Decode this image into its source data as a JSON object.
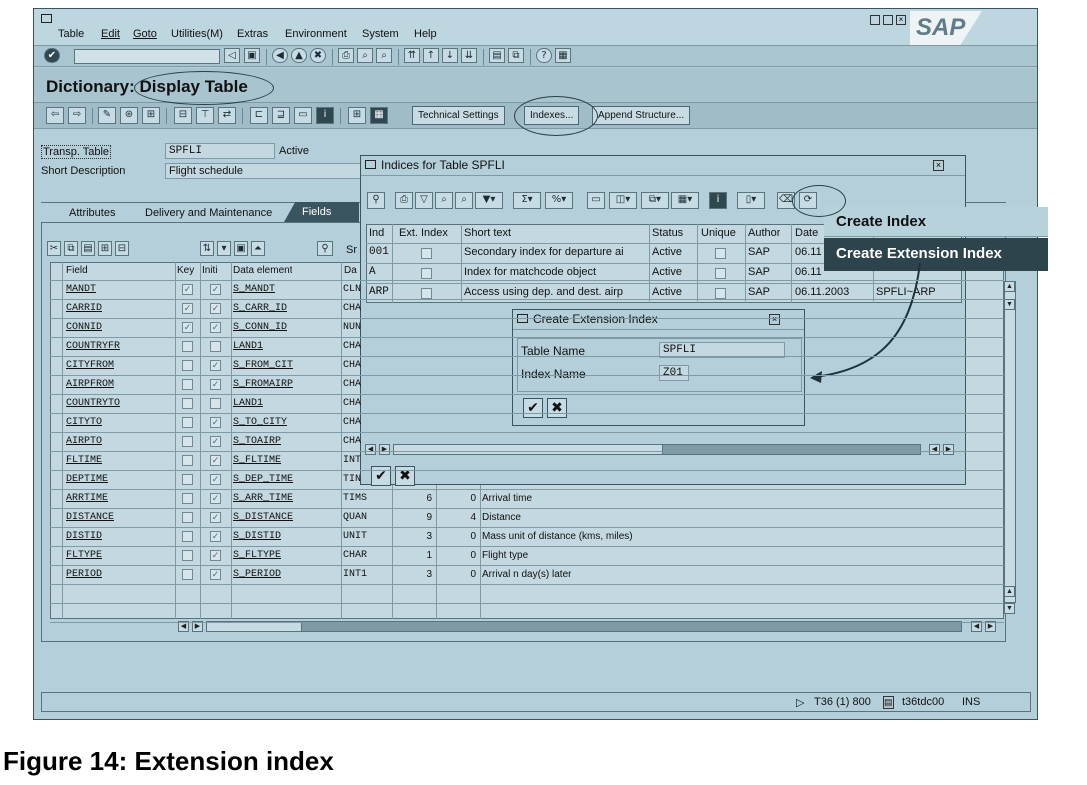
{
  "menu": {
    "items": [
      "Table",
      "Edit",
      "Goto",
      "Utilities(M)",
      "Extras",
      "Environment",
      "System",
      "Help"
    ]
  },
  "brand": {
    "logo": "SAP"
  },
  "title": {
    "text": "Dictionary: Display Table"
  },
  "app_toolbar": {
    "technical_settings": "Technical Settings",
    "indexes": "Indexes...",
    "append_structure": "Append Structure..."
  },
  "header": {
    "transp_label": "Transp. Table",
    "transp_value": "SPFLI",
    "status": "Active",
    "short_desc_label": "Short Description",
    "short_desc_value": "Flight schedule"
  },
  "tabs": [
    "Attributes",
    "Delivery and Maintenance",
    "Fields"
  ],
  "fields_table": {
    "search_label": "Sr",
    "columns": [
      "Field",
      "Key",
      "Initi",
      "Data element",
      "Da"
    ],
    "rows": [
      {
        "field": "MANDT",
        "key": true,
        "init": true,
        "element": "S_MANDT",
        "type": "CLN",
        "len": "",
        "dec": "",
        "desc": ""
      },
      {
        "field": "CARRID",
        "key": true,
        "init": true,
        "element": "S_CARR_ID",
        "type": "CHA",
        "len": "",
        "dec": "",
        "desc": ""
      },
      {
        "field": "CONNID",
        "key": true,
        "init": true,
        "element": "S_CONN_ID",
        "type": "NUN",
        "len": "",
        "dec": "",
        "desc": ""
      },
      {
        "field": "COUNTRYFR",
        "key": false,
        "init": false,
        "element": "LAND1",
        "type": "CHA",
        "len": "",
        "dec": "",
        "desc": ""
      },
      {
        "field": "CITYFROM",
        "key": false,
        "init": true,
        "element": "S_FROM_CIT",
        "type": "CHA",
        "len": "",
        "dec": "",
        "desc": ""
      },
      {
        "field": "AIRPFROM",
        "key": false,
        "init": true,
        "element": "S_FROMAIRP",
        "type": "CHA",
        "len": "",
        "dec": "",
        "desc": ""
      },
      {
        "field": "COUNTRYTO",
        "key": false,
        "init": false,
        "element": "LAND1",
        "type": "CHA",
        "len": "",
        "dec": "",
        "desc": ""
      },
      {
        "field": "CITYTO",
        "key": false,
        "init": true,
        "element": "S_TO_CITY",
        "type": "CHA",
        "len": "",
        "dec": "",
        "desc": ""
      },
      {
        "field": "AIRPTO",
        "key": false,
        "init": true,
        "element": "S_TOAIRP",
        "type": "CHA",
        "len": "",
        "dec": "",
        "desc": ""
      },
      {
        "field": "FLTIME",
        "key": false,
        "init": true,
        "element": "S_FLTIME",
        "type": "INT",
        "len": "",
        "dec": "",
        "desc": ""
      },
      {
        "field": "DEPTIME",
        "key": false,
        "init": true,
        "element": "S_DEP_TIME",
        "type": "TIN",
        "len": "",
        "dec": "",
        "desc": ""
      },
      {
        "field": "ARRTIME",
        "key": false,
        "init": true,
        "element": "S_ARR_TIME",
        "type": "TIMS",
        "len": "6",
        "dec": "0",
        "desc": "Arrival time"
      },
      {
        "field": "DISTANCE",
        "key": false,
        "init": true,
        "element": "S_DISTANCE",
        "type": "QUAN",
        "len": "9",
        "dec": "4",
        "desc": "Distance"
      },
      {
        "field": "DISTID",
        "key": false,
        "init": true,
        "element": "S_DISTID",
        "type": "UNIT",
        "len": "3",
        "dec": "0",
        "desc": "Mass unit of distance (kms, miles)"
      },
      {
        "field": "FLTYPE",
        "key": false,
        "init": true,
        "element": "S_FLTYPE",
        "type": "CHAR",
        "len": "1",
        "dec": "0",
        "desc": "Flight type"
      },
      {
        "field": "PERIOD",
        "key": false,
        "init": true,
        "element": "S_PERIOD",
        "type": "INT1",
        "len": "3",
        "dec": "0",
        "desc": "Arrival n day(s) later"
      }
    ]
  },
  "indices_dialog": {
    "title": "Indices for Table SPFLI",
    "columns": [
      "Ind",
      "Ext. Index",
      "Short text",
      "Status",
      "Unique",
      "Author",
      "Date",
      ""
    ],
    "rows": [
      {
        "ind": "001",
        "ext": false,
        "text": "Secondary index for departure ai",
        "status": "Active",
        "unique": false,
        "author": "SAP",
        "date": "06.11",
        "name": ""
      },
      {
        "ind": "A",
        "ext": false,
        "text": "Index for matchcode object",
        "status": "Active",
        "unique": false,
        "author": "SAP",
        "date": "06.11",
        "name": ""
      },
      {
        "ind": "ARP",
        "ext": false,
        "text": "Access using dep. and dest. airp",
        "status": "Active",
        "unique": false,
        "author": "SAP",
        "date": "06.11.2003",
        "name": "SPFLI~ARP"
      }
    ]
  },
  "create_menu": {
    "items": [
      "Create Index",
      "Create Extension Index"
    ]
  },
  "ext_dialog": {
    "title": "Create Extension Index",
    "table_label": "Table Name",
    "table_value": "SPFLI",
    "index_label": "Index Name",
    "index_value": "Z01"
  },
  "status_bar": {
    "system": "T36 (1) 800",
    "server": "t36tdc00",
    "mode": "INS"
  },
  "caption": {
    "text": "Figure 14:  Extension index"
  },
  "colors": {
    "background": "#b4cfd9",
    "popup": "#2e444d"
  }
}
